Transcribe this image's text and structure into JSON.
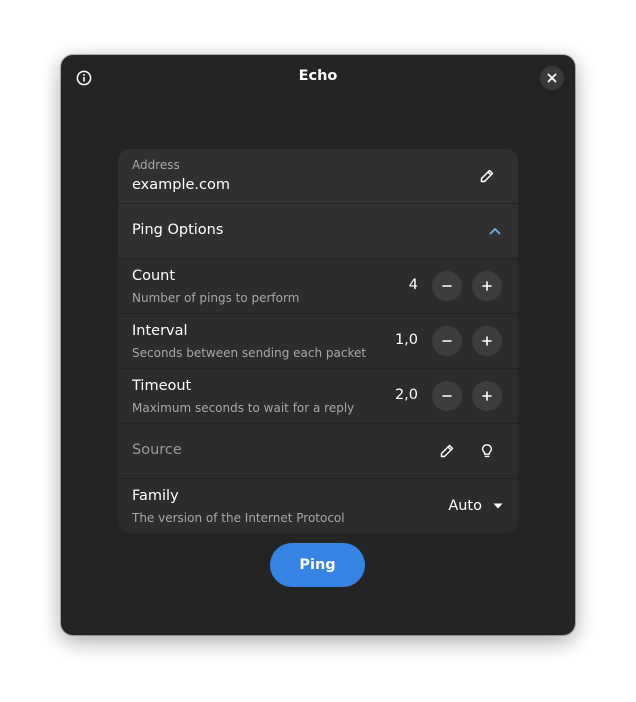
{
  "window": {
    "title": "Echo"
  },
  "address": {
    "label": "Address",
    "value": "example.com"
  },
  "ping_options": {
    "title": "Ping Options",
    "expanded": true
  },
  "count": {
    "title": "Count",
    "subtitle": "Number of pings to perform",
    "value": "4"
  },
  "interval": {
    "title": "Interval",
    "subtitle": "Seconds between sending each packet",
    "value": "1,0"
  },
  "timeout": {
    "title": "Timeout",
    "subtitle": "Maximum seconds to wait for a reply",
    "value": "2,0"
  },
  "source": {
    "placeholder": "Source"
  },
  "family": {
    "title": "Family",
    "subtitle": "The version of the Internet Protocol",
    "selected": "Auto"
  },
  "ping_button": {
    "label": "Ping"
  },
  "colors": {
    "accent": "#3584e4",
    "window_bg": "#242424",
    "card_bg": "#303030",
    "expander_arrow": "#78aeed"
  },
  "icons": {
    "about": "info-icon",
    "close": "close-icon",
    "edit": "pencil-icon",
    "expand": "chevron-up-icon",
    "decrement": "minus-icon",
    "increment": "plus-icon",
    "suggest": "lightbulb-icon",
    "dropdown": "pan-down-icon"
  }
}
